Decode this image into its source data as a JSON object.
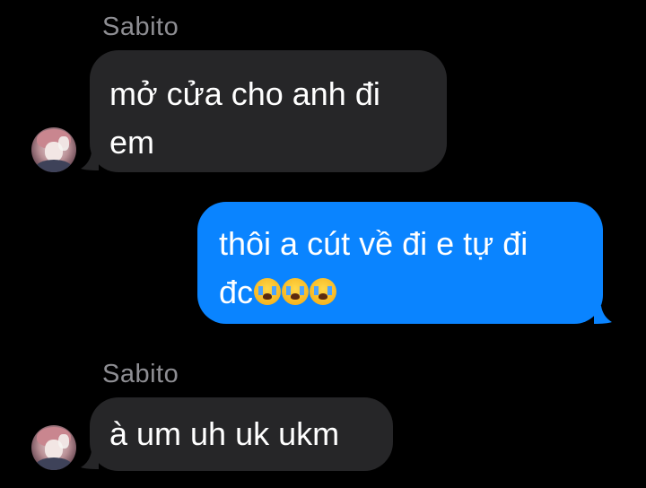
{
  "conversation": {
    "messages": [
      {
        "direction": "incoming",
        "sender": "Sabito",
        "lines": [
          "mở cửa cho anh đi",
          "em"
        ]
      },
      {
        "direction": "outgoing",
        "lines": [
          "thôi a cút về đi e tự đi",
          "đc"
        ],
        "emoji": [
          "loudly-crying-face",
          "loudly-crying-face",
          "loudly-crying-face"
        ]
      },
      {
        "direction": "incoming",
        "sender": "Sabito",
        "lines": [
          "à um uh uk ukm"
        ]
      }
    ]
  },
  "colors": {
    "background": "#000000",
    "incoming_bubble": "#262628",
    "outgoing_bubble": "#0a84ff",
    "sender_name": "#8e8e93",
    "text": "#ffffff"
  }
}
